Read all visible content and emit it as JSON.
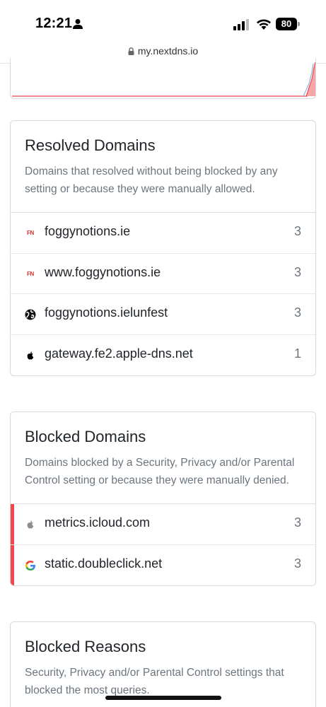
{
  "status_bar": {
    "time": "12:21",
    "battery_level": "80"
  },
  "browser": {
    "url": "my.nextdns.io"
  },
  "chart_colors": {
    "line": "#f0464c",
    "fill": "#f7a6a8",
    "blue": "#8ab4e8"
  },
  "resolved_domains": {
    "title": "Resolved Domains",
    "description": "Domains that resolved without being blocked by any setting or because they were manually allowed.",
    "items": [
      {
        "icon": "fn-icon",
        "icon_text": "FN",
        "domain": "foggynotions.ie",
        "count": "3"
      },
      {
        "icon": "fn-icon",
        "icon_text": "FN",
        "domain": "www.foggynotions.ie",
        "count": "3"
      },
      {
        "icon": "globe-icon",
        "domain": "foggynotions.ielunfest",
        "count": "3"
      },
      {
        "icon": "apple-icon",
        "domain": "gateway.fe2.apple-dns.net",
        "count": "1"
      }
    ]
  },
  "blocked_domains": {
    "title": "Blocked Domains",
    "description": "Domains blocked by a Security, Privacy and/or Parental Control setting or because they were manually denied.",
    "accent_color": "#f0464c",
    "items": [
      {
        "icon": "apple-icon",
        "domain": "metrics.icloud.com",
        "count": "3"
      },
      {
        "icon": "google-icon",
        "domain": "static.doubleclick.net",
        "count": "3"
      }
    ]
  },
  "blocked_reasons": {
    "title": "Blocked Reasons",
    "description": "Security, Privacy and/or Parental Control settings that blocked the most queries."
  }
}
